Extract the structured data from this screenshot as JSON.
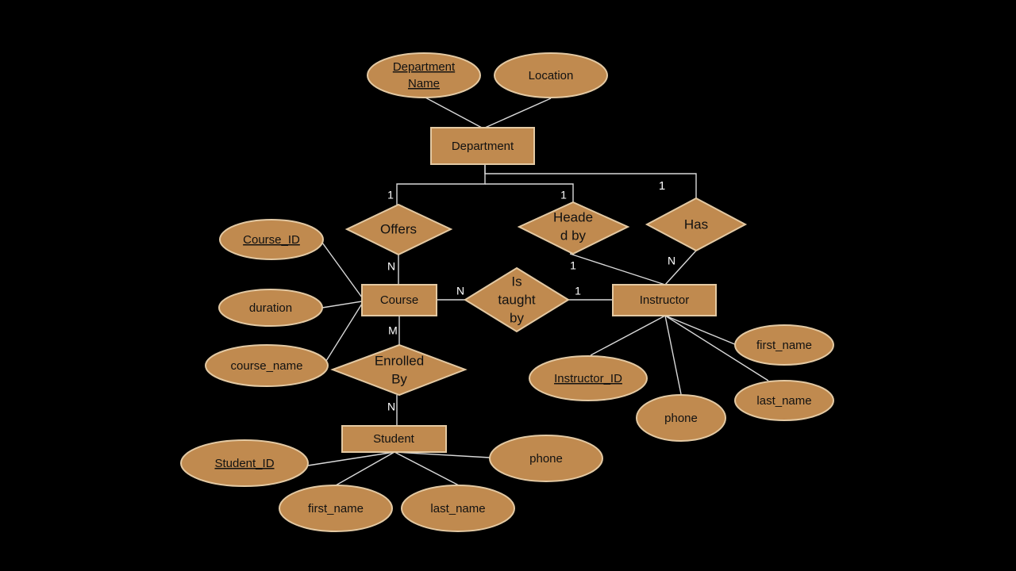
{
  "entities": {
    "department": "Department",
    "course": "Course",
    "instructor": "Instructor",
    "student": "Student"
  },
  "relationships": {
    "offers": [
      "Offers"
    ],
    "headed_by": [
      "Heade",
      "d by"
    ],
    "has": [
      "Has"
    ],
    "is_taught_by": [
      "Is",
      "taught",
      "by"
    ],
    "enrolled_by": [
      "Enrolled",
      "By"
    ]
  },
  "attributes": {
    "department_name": [
      "Department",
      "Name"
    ],
    "location": "Location",
    "course_id": "Course_ID",
    "duration": "duration",
    "course_name": "course_name",
    "instructor_id": "Instructor_ID",
    "instructor_first_name": "first_name",
    "instructor_last_name": "last_name",
    "instructor_phone": "phone",
    "student_id": "Student_ID",
    "student_phone": "phone",
    "student_first_name": "first_name",
    "student_last_name": "last_name"
  },
  "cardinalities": {
    "offers_department": "1",
    "headed_by_department": "1",
    "has_department": "1",
    "offers_course": "N",
    "headed_by_instructor": "1",
    "has_instructor": "N",
    "taught_course": "N",
    "taught_instructor": "1",
    "enrolled_course": "M",
    "enrolled_student": "N"
  }
}
